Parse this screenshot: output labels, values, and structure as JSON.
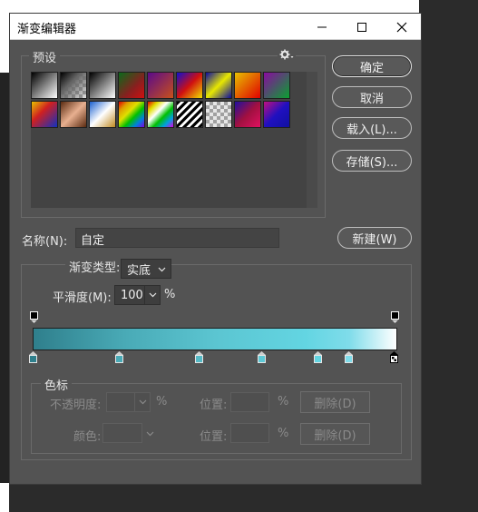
{
  "window": {
    "title": "渐变编辑器"
  },
  "presets": {
    "legend": "预设",
    "gear_icon": "gear-icon"
  },
  "buttons": {
    "ok": "确定",
    "cancel": "取消",
    "load": "载入(L)...",
    "save": "存储(S)...",
    "new": "新建(W)"
  },
  "name": {
    "label": "名称(N):",
    "value": "自定"
  },
  "gradient": {
    "type_label": "渐变类型:",
    "type_value": "实底",
    "smoothness_label": "平滑度(M):",
    "smoothness_value": "100",
    "smoothness_unit": "%"
  },
  "stops": {
    "legend": "色标",
    "opacity_label": "不透明度:",
    "opacity_unit": "%",
    "opacity_location_label": "位置:",
    "opacity_location_unit": "%",
    "opacity_delete": "删除(D)",
    "color_label": "颜色:",
    "color_location_label": "位置:",
    "color_location_unit": "%",
    "color_delete": "删除(D)"
  },
  "colors": {
    "window_bg": "#535353",
    "gradient_start": "#2f7f8c",
    "gradient_end": "#ffffff"
  }
}
